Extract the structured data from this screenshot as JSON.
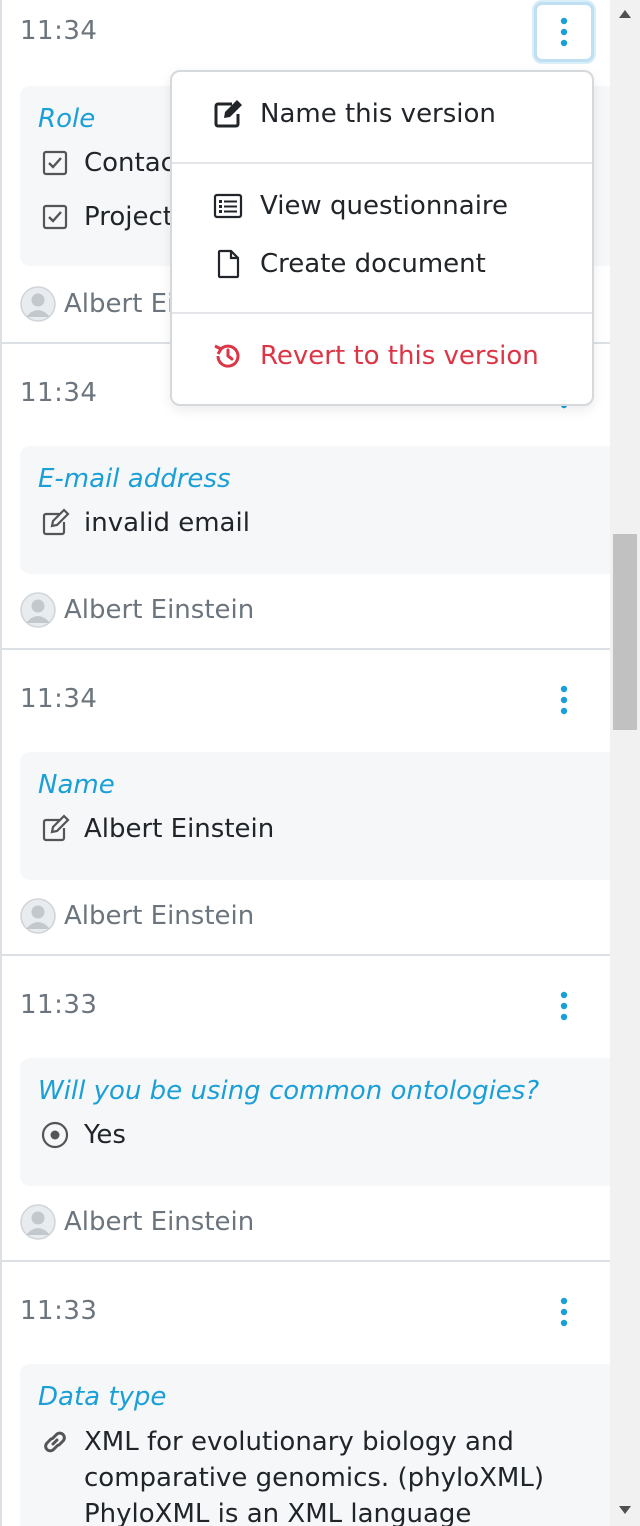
{
  "events": [
    {
      "time": "11:34",
      "question": "Role",
      "answers": [
        "Contact Person",
        "Project Leader"
      ],
      "user": "Albert Einstein"
    },
    {
      "time": "11:34",
      "question": "E-mail address",
      "answer": "invalid email",
      "user": "Albert Einstein"
    },
    {
      "time": "11:34",
      "question": "Name",
      "answer": "Albert Einstein",
      "user": "Albert Einstein"
    },
    {
      "time": "11:33",
      "question": "Will you be using common ontologies?",
      "answer": "Yes",
      "user": "Albert Einstein"
    },
    {
      "time": "11:33",
      "question": "Data type",
      "answer": "XML for evolutionary biology and comparative genomics. (phyloXML) PhyloXML is an XML language",
      "user": ""
    }
  ],
  "menu": {
    "name_version": "Name this version",
    "view_questionnaire": "View questionnaire",
    "create_document": "Create document",
    "revert": "Revert to this version"
  },
  "colors": {
    "accent": "#1a9fd6",
    "danger": "#dc3545",
    "muted": "#6c757d"
  }
}
